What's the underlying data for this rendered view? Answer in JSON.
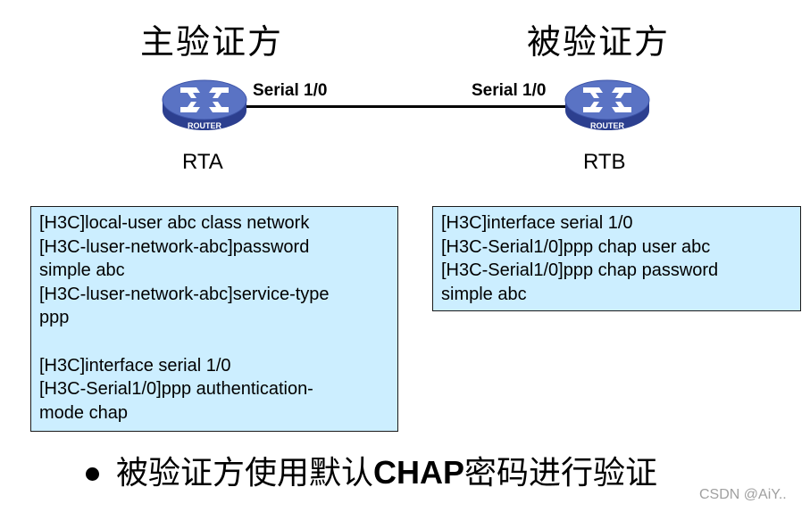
{
  "diagram": {
    "roles": {
      "authenticator": "主验证方",
      "authenticatee": "被验证方"
    },
    "routers": [
      {
        "name": "RTA",
        "device_label": "ROUTER",
        "icon": "router-icon",
        "interface": "Serial 1/0"
      },
      {
        "name": "RTB",
        "device_label": "ROUTER",
        "icon": "router-icon",
        "interface": "Serial 1/0"
      }
    ],
    "colors": {
      "router_top": "#5a73c4",
      "router_side": "#2c3f8f",
      "config_bg": "#cceeff",
      "watermark": "#a0a0a0"
    }
  },
  "config_a": {
    "lines": [
      "[H3C]local-user abc class network",
      "[H3C-luser-network-abc]password",
      "simple abc",
      "[H3C-luser-network-abc]service-type",
      "ppp",
      "",
      "[H3C]interface serial 1/0",
      "[H3C-Serial1/0]ppp authentication-",
      "mode chap"
    ]
  },
  "config_b": {
    "lines": [
      "[H3C]interface serial 1/0",
      "[H3C-Serial1/0]ppp chap user abc",
      "[H3C-Serial1/0]ppp chap password",
      "simple abc"
    ]
  },
  "summary": {
    "part1": "被验证方使用默认",
    "part2": "CHAP",
    "part3": "密码进行验证"
  },
  "watermark": "CSDN @AiY.."
}
